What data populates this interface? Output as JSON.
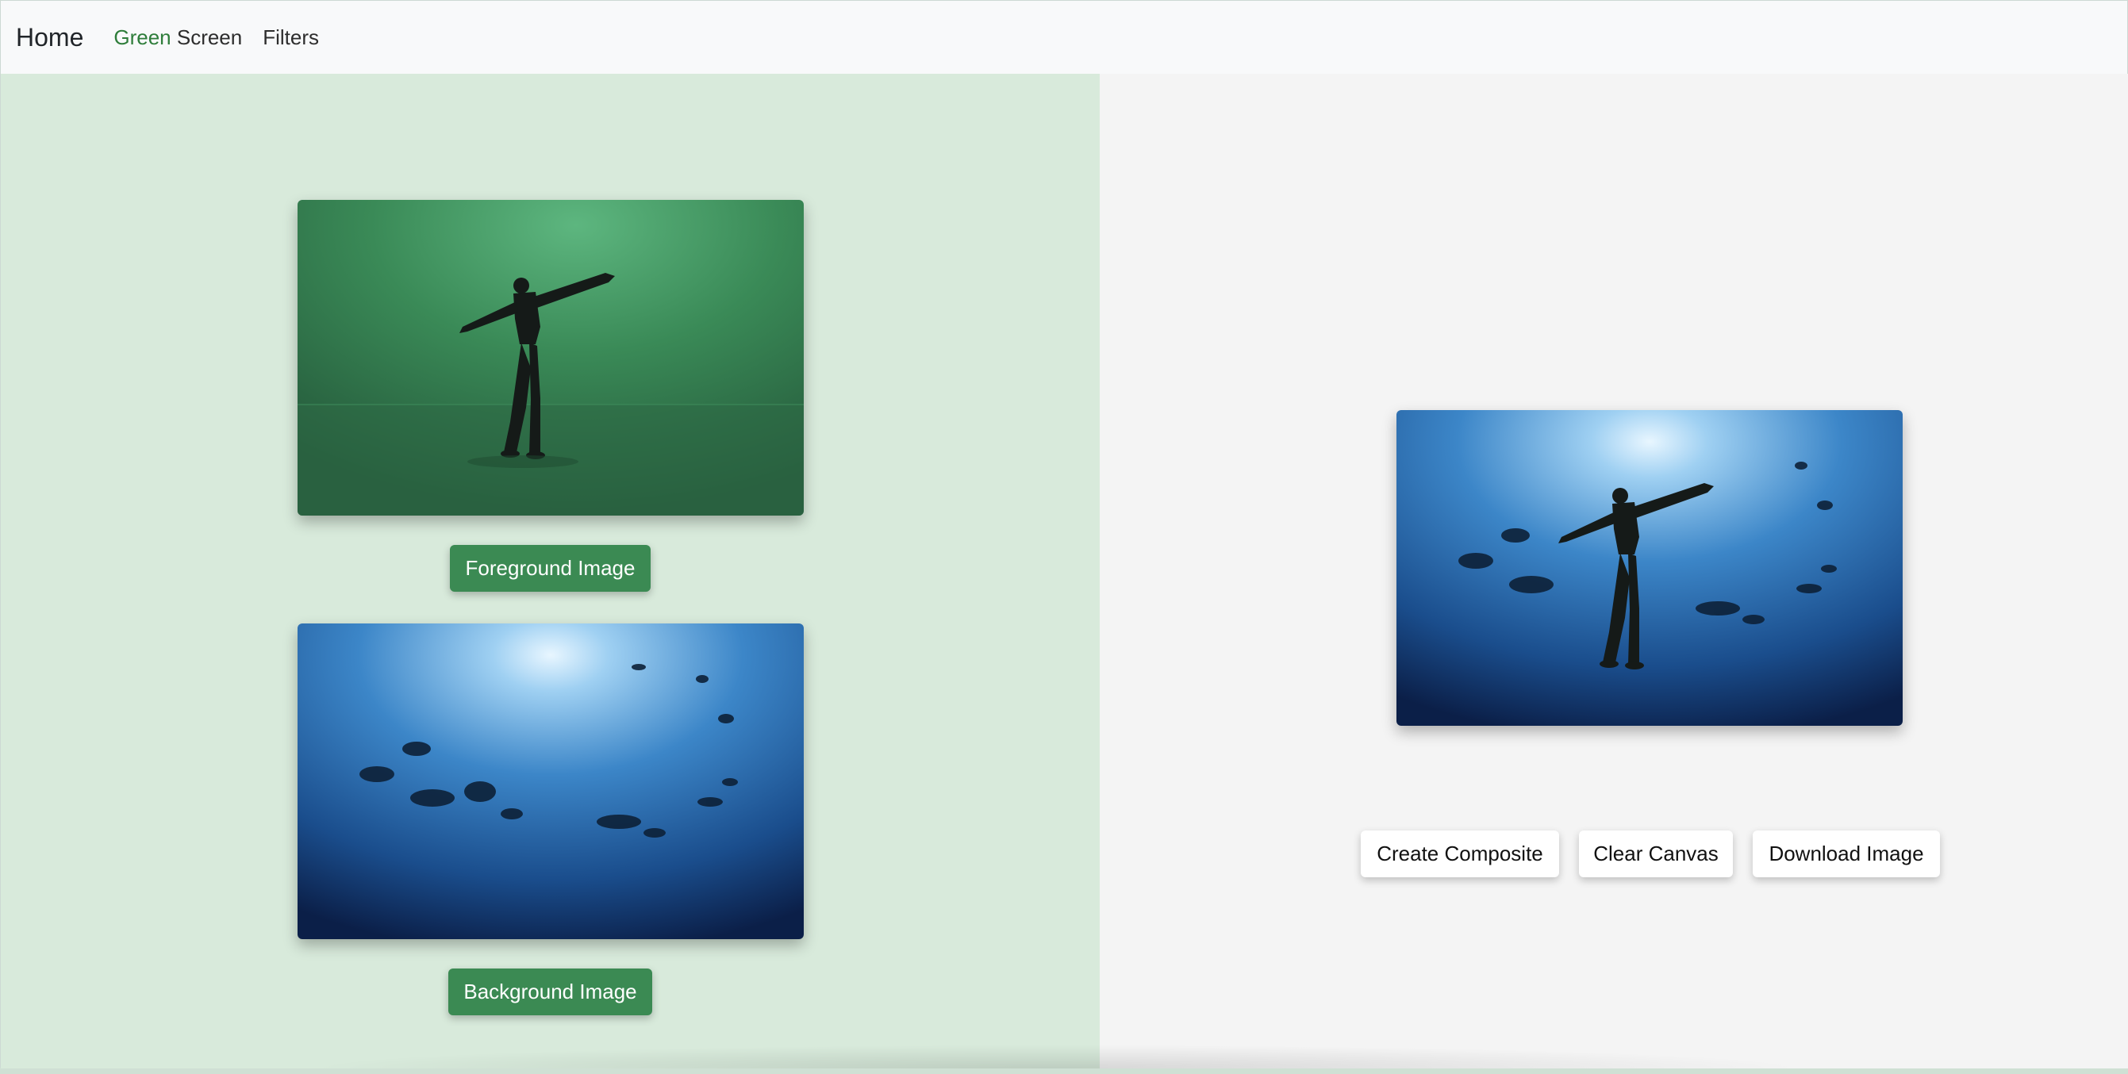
{
  "nav": {
    "brand": "Home",
    "green_screen_accent": "Green",
    "green_screen_rest": " Screen",
    "filters": "Filters"
  },
  "left": {
    "foreground_button": "Foreground Image",
    "background_button": "Background Image"
  },
  "right": {
    "create_button": "Create Composite",
    "clear_button": "Clear Canvas",
    "download_button": "Download Image"
  },
  "colors": {
    "accent": "#2e7d3a",
    "button_green": "#3b8a53",
    "left_panel_bg": "#d8eadb",
    "right_panel_bg": "#f4f4f4"
  },
  "images": {
    "foreground": "green-screen-dancer-photo",
    "background": "underwater-fish-photo",
    "composite": "composite-canvas-photo"
  }
}
